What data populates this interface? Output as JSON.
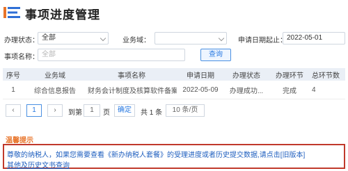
{
  "header": {
    "title": "事项进度管理"
  },
  "form": {
    "status_label": "办理状态：",
    "status_value": "全部",
    "domain_label": "业务域：",
    "domain_value": "",
    "date_label": "申请日期起止：",
    "date_value": "2022-05-01",
    "item_label": "事项名称：",
    "item_placeholder": "全部",
    "query_button": "查询"
  },
  "table": {
    "headers": [
      "序号",
      "业务域",
      "事项名称",
      "申请日期",
      "办理状态",
      "办理环节",
      "总环节数"
    ],
    "rows": [
      [
        "1",
        "综合信息报告",
        "财务会计制度及核算软件备案...",
        "2022-05-09",
        "办理成功...",
        "完成",
        "4"
      ]
    ]
  },
  "pagination": {
    "prev": "‹",
    "current_page": "1",
    "next": "›",
    "goto_label": "到第",
    "goto_value": "1",
    "page_unit": "页",
    "confirm": "确定",
    "total": "共 1 条",
    "page_size": "10 条/页"
  },
  "tip": {
    "title": "温馨提示",
    "text": "尊敬的纳税人，如果您需要查看《新办纳税人套餐》的受理进度或者历史提交数据,请点击[旧版本]",
    "link": "其他及历史文书查询"
  },
  "colors": {
    "accent": "#2a7ae2",
    "tip_border": "#c0392b",
    "tip_title": "#e8742a"
  }
}
